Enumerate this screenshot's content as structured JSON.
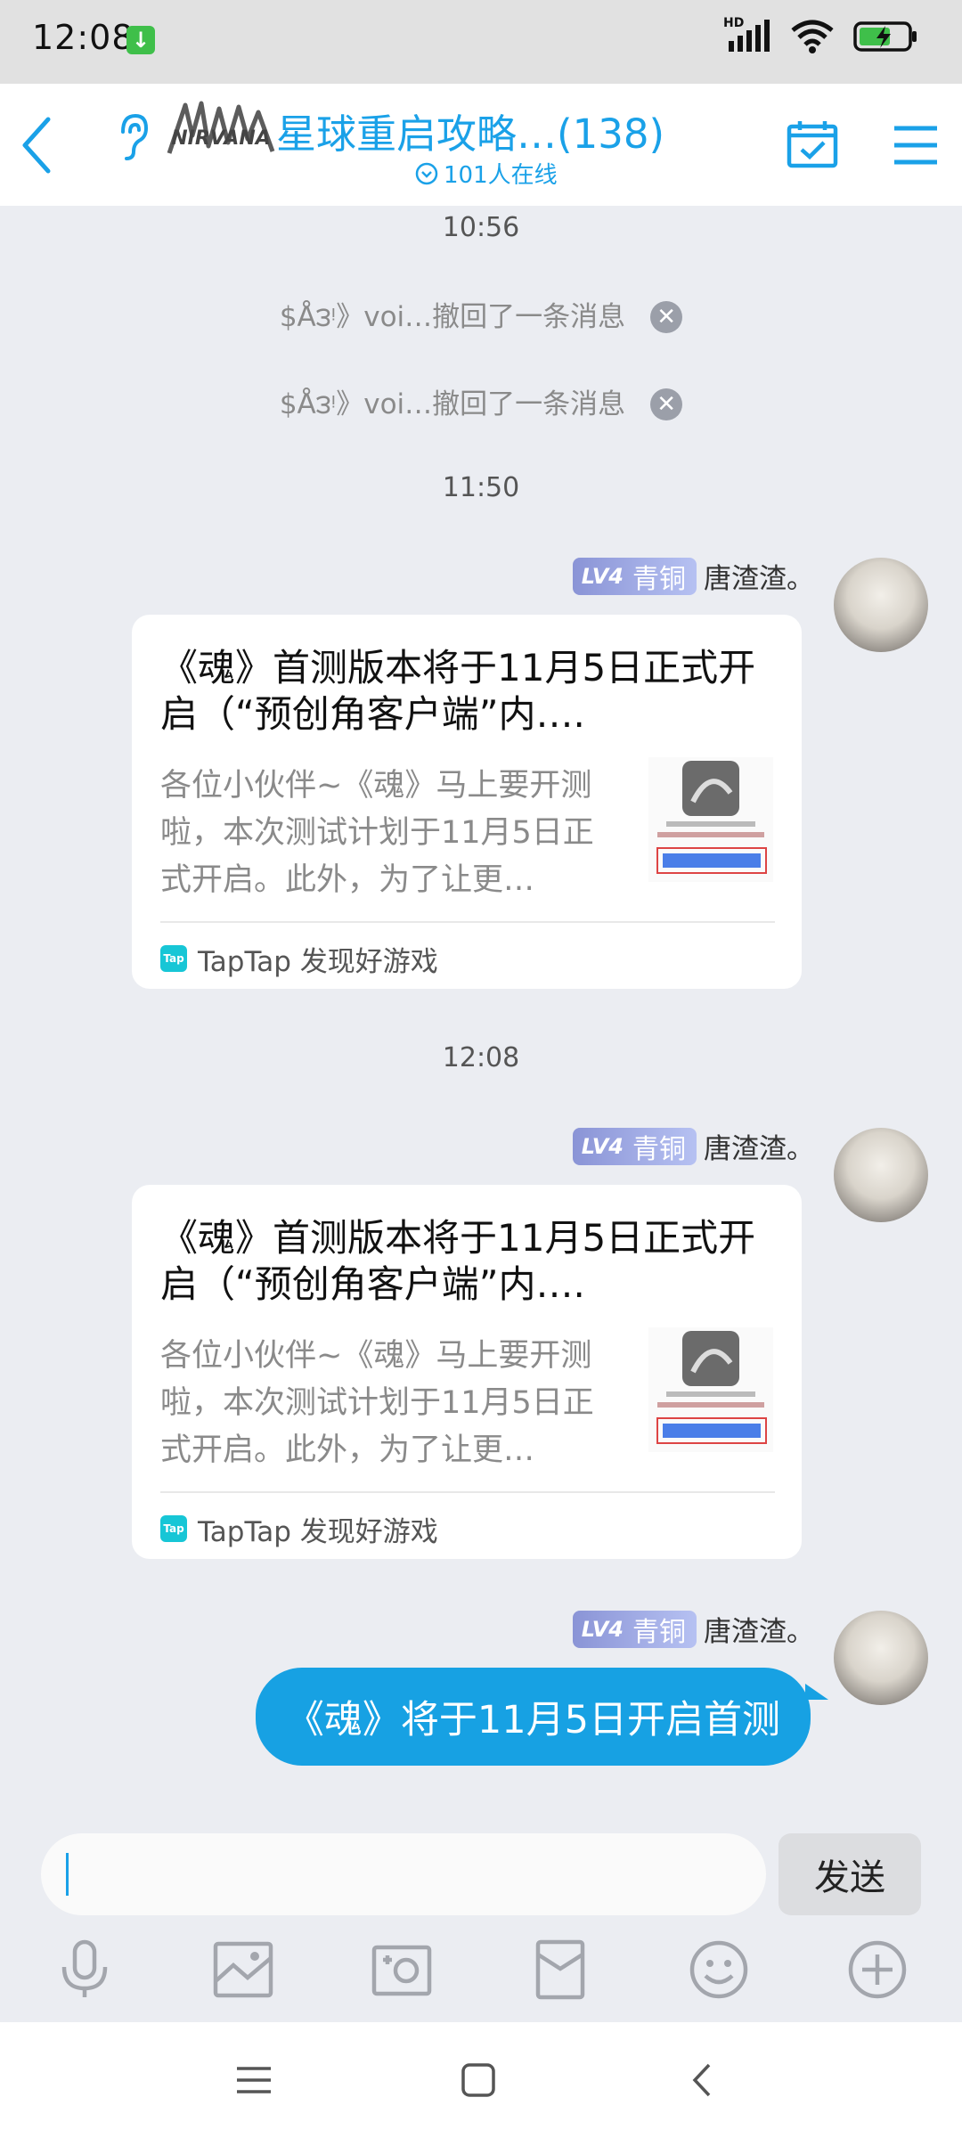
{
  "status_bar": {
    "time": "12:08",
    "network": "HD"
  },
  "header": {
    "group_name": "星球重启攻略…",
    "member_count": "(138)",
    "online": "101人在线",
    "logo_text": "NIRVANA",
    "accent_color": "#1aa1e8"
  },
  "chat": {
    "timestamps": [
      "10:56",
      "11:50",
      "12:08"
    ],
    "recalls": [
      {
        "text": "$Å౩ᵎ》voi…撤回了一条消息"
      },
      {
        "text": "$Å౩ᵎ》voi…撤回了一条消息"
      }
    ],
    "messages": [
      {
        "level_tag": "LV4",
        "level_name": "青铜",
        "sender": "唐渣渣。",
        "card_title": "《魂》首测版本将于11月5日正式开启（“预创角客户端”内….",
        "card_desc": "各位小伙伴~《魂》马上要开测啦，本次测试计划于11月5日正式开启。此外，为了让更…",
        "card_source": "TapTap 发现好游戏",
        "tap_logo": "Tap"
      },
      {
        "level_tag": "LV4",
        "level_name": "青铜",
        "sender": "唐渣渣。",
        "card_title": "《魂》首测版本将于11月5日正式开启（“预创角客户端”内….",
        "card_desc": "各位小伙伴~《魂》马上要开测啦，本次测试计划于11月5日正式开启。此外，为了让更…",
        "card_source": "TapTap 发现好游戏",
        "tap_logo": "Tap"
      },
      {
        "level_tag": "LV4",
        "level_name": "青铜",
        "sender": "唐渣渣。",
        "text": "《魂》将于11月5日开启首测"
      }
    ]
  },
  "input": {
    "value": "",
    "send_label": "发送"
  },
  "toolbar": {
    "icons": [
      "microphone-icon",
      "image-icon",
      "camera-icon",
      "red-packet-icon",
      "emoji-icon",
      "plus-icon"
    ]
  },
  "nav": {
    "icons": [
      "menu-icon",
      "home-icon",
      "back-icon"
    ]
  }
}
